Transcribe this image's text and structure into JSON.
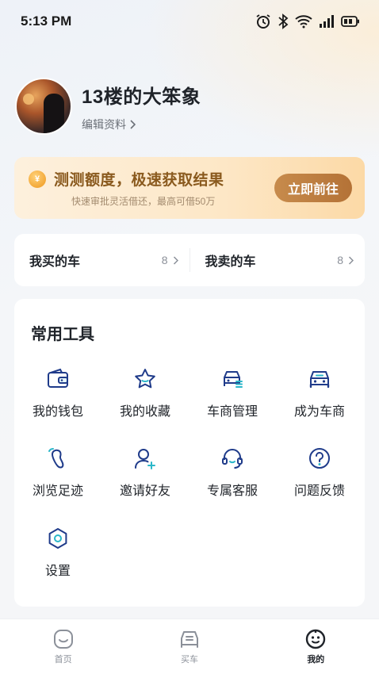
{
  "status_bar": {
    "time": "5:13 PM"
  },
  "profile": {
    "username": "13楼的大笨象",
    "edit_label": "编辑资料"
  },
  "promo": {
    "coin_symbol": "¥",
    "title": "测测额度，极速获取结果",
    "subtitle": "快速审批灵活借还，最高可借50万",
    "button_label": "立即前往"
  },
  "orders": {
    "bought": {
      "label": "我买的车",
      "count": "8"
    },
    "sold": {
      "label": "我卖的车",
      "count": "8"
    }
  },
  "tools": {
    "title": "常用工具",
    "items": [
      {
        "label": "我的钱包",
        "icon": "wallet-icon"
      },
      {
        "label": "我的收藏",
        "icon": "star-icon"
      },
      {
        "label": "车商管理",
        "icon": "dealer-manage-icon"
      },
      {
        "label": "成为车商",
        "icon": "car-icon"
      },
      {
        "label": "浏览足迹",
        "icon": "footprint-icon"
      },
      {
        "label": "邀请好友",
        "icon": "add-friend-icon"
      },
      {
        "label": "专属客服",
        "icon": "headset-icon"
      },
      {
        "label": "问题反馈",
        "icon": "question-icon"
      },
      {
        "label": "设置",
        "icon": "settings-icon"
      }
    ]
  },
  "nav": {
    "items": [
      {
        "label": "首页",
        "icon": "home-icon"
      },
      {
        "label": "买车",
        "icon": "buy-car-icon"
      },
      {
        "label": "我的",
        "icon": "profile-icon",
        "active": true
      }
    ]
  },
  "colors": {
    "accent_brown": "#b47236",
    "primary_text": "#1f2329",
    "icon_blue": "#1f3b8a"
  }
}
